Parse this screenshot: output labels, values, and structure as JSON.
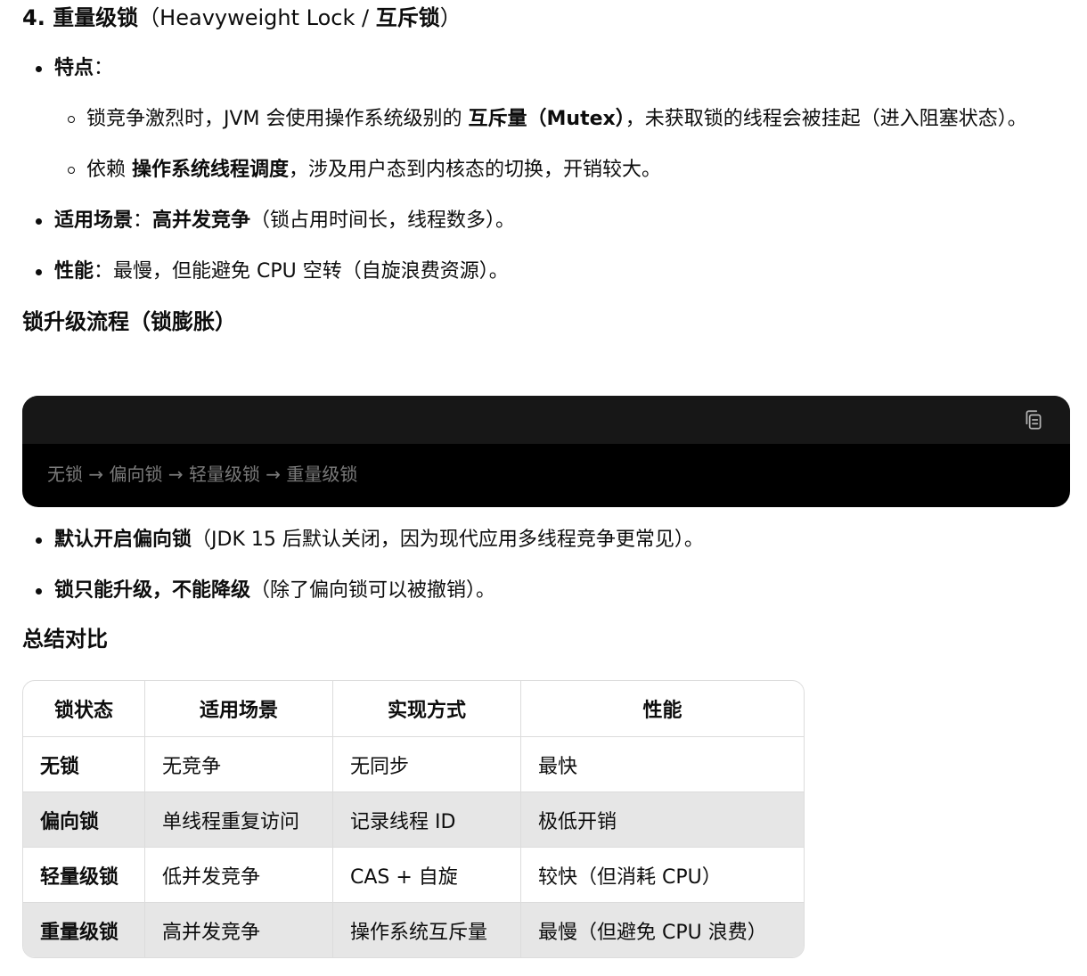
{
  "heavy": {
    "heading_num": "4.",
    "heading_bold1": "重量级锁",
    "heading_light": "（Heavyweight Lock / ",
    "heading_bold2": "互斥锁",
    "heading_end": "）",
    "feature_label": "特点",
    "feature_colon": "：",
    "sub1_pre": "锁竞争激烈时，JVM 会使用操作系统级别的 ",
    "sub1_bold": "互斥量（Mutex）",
    "sub1_post": "，未获取锁的线程会被挂起（进入阻塞状态）。",
    "sub2_pre": "依赖 ",
    "sub2_bold": "操作系统线程调度",
    "sub2_post": "，涉及用户态到内核态的切换，开销较大。",
    "scene_label": "适用场景",
    "scene_colon": "：",
    "scene_bold": "高并发竞争",
    "scene_post": "（锁占用时间长，线程数多）。",
    "perf_label": "性能",
    "perf_text": "：最慢，但能避免 CPU 空转（自旋浪费资源）。"
  },
  "upgrade": {
    "heading": "锁升级流程（锁膨胀）",
    "code": "无锁 → 偏向锁 → 轻量级锁 → 重量级锁",
    "note1_bold": "默认开启偏向锁",
    "note1_post": "（JDK 15 后默认关闭，因为现代应用多线程竞争更常见）。",
    "note2_bold": "锁只能升级，不能降级",
    "note2_post": "（除了偏向锁可以被撤销）。"
  },
  "summary": {
    "heading": "总结对比",
    "headers": [
      "锁状态",
      "适用场景",
      "实现方式",
      "性能"
    ],
    "rows": [
      [
        "无锁",
        "无竞争",
        "无同步",
        "最快"
      ],
      [
        "偏向锁",
        "单线程重复访问",
        "记录线程 ID",
        "极低开销"
      ],
      [
        "轻量级锁",
        "低并发竞争",
        "CAS + 自旋",
        "较快（但消耗 CPU）"
      ],
      [
        "重量级锁",
        "高并发竞争",
        "操作系统互斥量",
        "最慢（但避免 CPU 浪费）"
      ]
    ]
  },
  "icons": {
    "copy": "copy-icon"
  },
  "colors": {
    "code_bg": "#000000",
    "code_header_bg": "#171717",
    "shaded_row": "#e6e6e6",
    "border": "#dcdcdc"
  }
}
